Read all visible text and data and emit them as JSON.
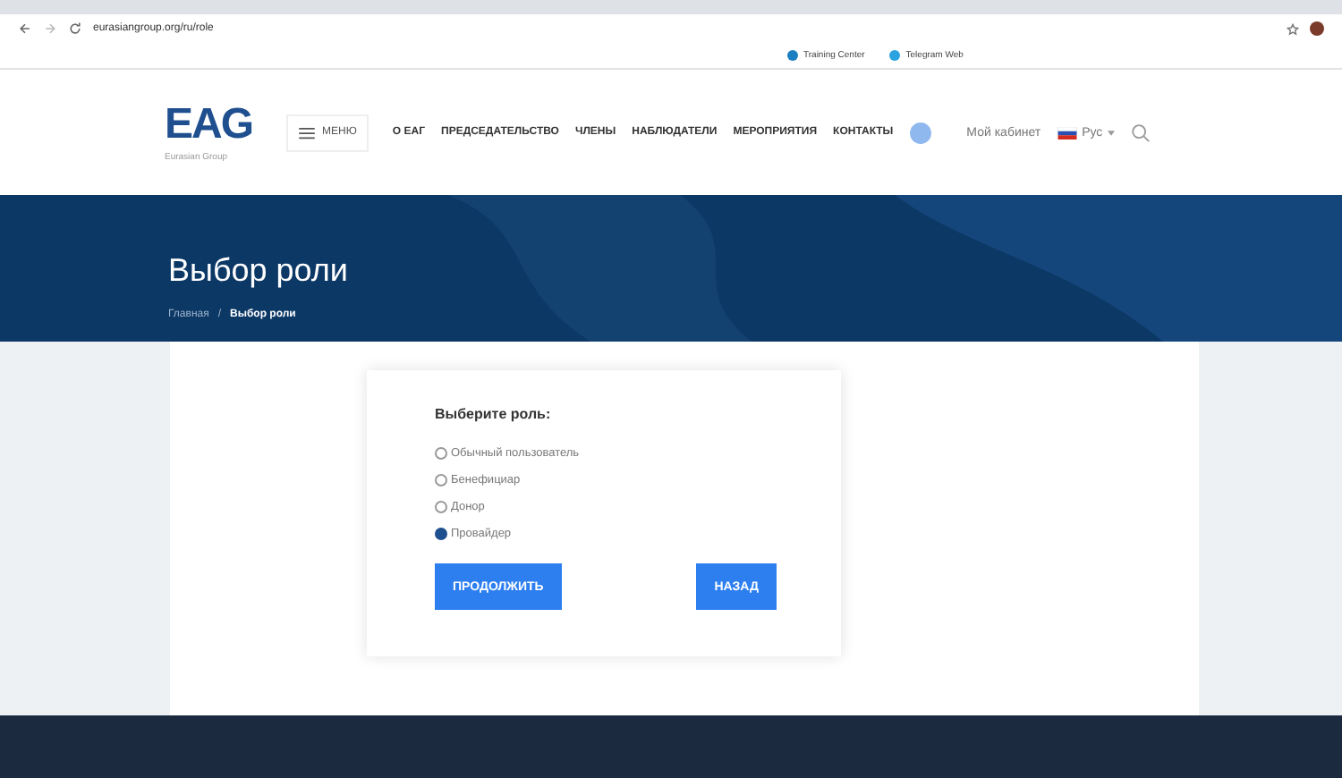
{
  "browser": {
    "address": "eurasiangroup.org/ru/role",
    "bookmarks": [
      {
        "label": "Training Center",
        "color": "#1a7fc1"
      },
      {
        "label": "Telegram Web",
        "color": "#2aa3e0"
      }
    ]
  },
  "header": {
    "logo": "EAG",
    "logo_subtitle": "Eurasian Group",
    "menu_button": "МЕНЮ",
    "nav": [
      "О ЕАГ",
      "ПРЕДСЕДАТЕЛЬСТВО",
      "ЧЛЕНЫ",
      "НАБЛЮДАТЕЛИ",
      "МЕРОПРИЯТИЯ",
      "КОНТАКТЫ"
    ],
    "account": "Мой кабинет",
    "language": "Рус"
  },
  "banner": {
    "title": "Выбор роли",
    "separator": "/",
    "breadcrumbs": [
      {
        "label": "Главная",
        "selected": false
      },
      {
        "label": "Выбор роли",
        "selected": true
      }
    ]
  },
  "form": {
    "heading": "Выберите роль:",
    "options": [
      {
        "label": "Обычный пользователь",
        "selected": false
      },
      {
        "label": "Бенефициар",
        "selected": false
      },
      {
        "label": "Донор",
        "selected": false
      },
      {
        "label": "Провайдер",
        "selected": true
      }
    ],
    "buttons": [
      "ПРОДОЛЖИТЬ",
      "НАЗАД"
    ]
  }
}
